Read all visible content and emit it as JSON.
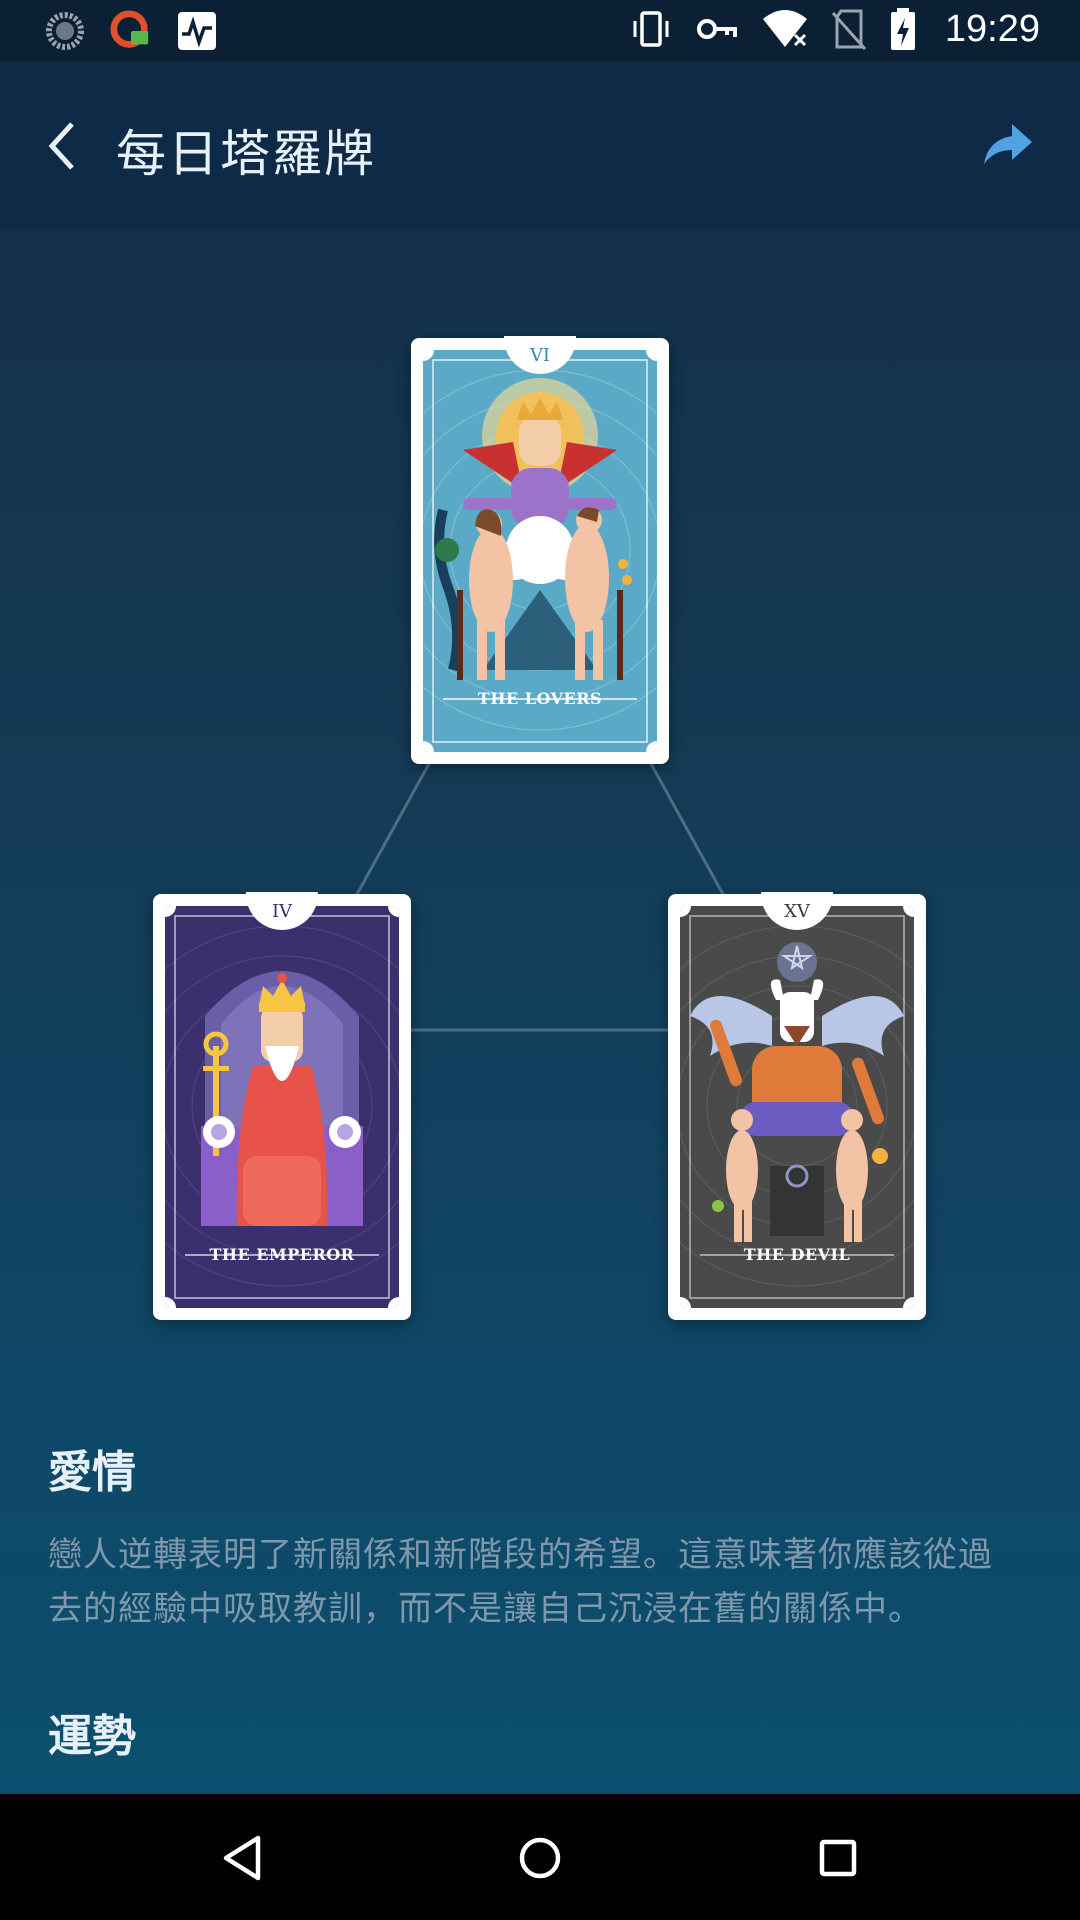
{
  "status_bar": {
    "time": "19:29",
    "left_icons": [
      "loading-circle-icon",
      "vpn-app-icon",
      "activity-monitor-icon"
    ],
    "right_icons": [
      "vibrate-icon",
      "key-icon",
      "wifi-off-icon",
      "no-sim-icon",
      "battery-charging-icon"
    ]
  },
  "app_bar": {
    "title": "每日塔羅牌",
    "back_icon": "chevron-left-icon",
    "share_icon": "share-arrow-icon"
  },
  "spread": {
    "cards": [
      {
        "numeral": "VI",
        "name": "THE LOVERS",
        "color": "#5aa9c6"
      },
      {
        "numeral": "IV",
        "name": "THE EMPEROR",
        "color": "#3b2f6e"
      },
      {
        "numeral": "XV",
        "name": "THE DEVIL",
        "color": "#4a4a4a"
      }
    ]
  },
  "sections": [
    {
      "title": "愛情",
      "body_line1": "戀人逆轉表明了新關係和新階段的希望。這意味著你應該從過",
      "body_line2": "去的經驗中吸取教訓，而不是讓自己沉浸在舊的關係中。"
    },
    {
      "title": "運勢"
    }
  ],
  "nav_bar": {
    "icons": [
      "back-triangle-icon",
      "home-circle-icon",
      "recents-square-icon"
    ]
  },
  "colors": {
    "app_bar": "#0e2a47",
    "status_bar": "#0c2035",
    "accent": "#4fa3e0",
    "body_text": "#7f98ab"
  }
}
